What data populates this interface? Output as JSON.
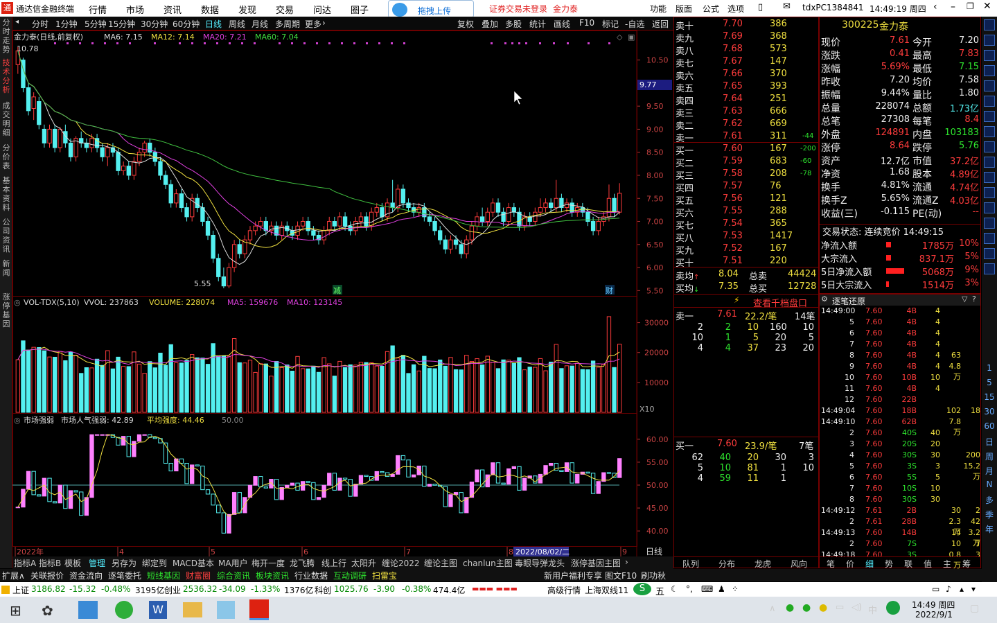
{
  "titlebar": {
    "app_name": "通达信金融终端",
    "menus": [
      "行情",
      "市场",
      "资讯",
      "数据",
      "发现",
      "交易",
      "问达",
      "圈子"
    ],
    "upload_label": "拖拽上传",
    "login_warning": "证券交易未登录",
    "stock_name": "金力泰",
    "right_menus": [
      "功能",
      "版面",
      "公式",
      "选项"
    ],
    "user_id": "tdxPC1384841",
    "clock": "14:49:19 周四"
  },
  "left_tabs": [
    "分时走势",
    "技术分析",
    "成交明细",
    "分价表",
    "基本资料",
    "公司资讯",
    "新闻",
    "涨停基因"
  ],
  "period_bar": {
    "items": [
      "分时",
      "1分钟",
      "5分钟",
      "15分钟",
      "30分钟",
      "60分钟",
      "日线",
      "周线",
      "月线",
      "多周期",
      "更多"
    ],
    "tools": [
      "复权",
      "叠加",
      "多股",
      "统计",
      "画线",
      "F10",
      "标记",
      "-自选",
      "返回"
    ]
  },
  "kline": {
    "header": "金力泰(日线,前复权)",
    "ma6": "MA6: 7.15",
    "ma12": "MA12: 7.14",
    "ma20": "MA20: 7.21",
    "ma60": "MA60: 7.04",
    "y_ticks": [
      "10.50",
      "10.00",
      "9.50",
      "9.00",
      "8.50",
      "8.00",
      "7.50",
      "7.00",
      "6.50",
      "6.00",
      "5.50"
    ],
    "high_label": "10.78",
    "low_label": "5.55",
    "cursor_price": "9.77",
    "marker_jian": "减",
    "marker_cai": "财"
  },
  "volume": {
    "header": "VOL-TDX(5,10)",
    "vvol": "VVOL: 237863",
    "volume": "VOLUME: 228074",
    "ma5": "MA5: 159676",
    "ma10": "MA10: 123145",
    "y_ticks": [
      "30000",
      "20000",
      "10000"
    ],
    "unit": "X10"
  },
  "strength": {
    "header": "市场强弱",
    "popularity": "市场人气强弱: 42.89",
    "avg": "平均强度: 44.46",
    "ref": "50.00",
    "y_ticks": [
      "60.00",
      "55.00",
      "50.00",
      "45.00",
      "40.00"
    ],
    "x_labels": [
      "2022年",
      "4",
      "5",
      "6",
      "7",
      "8",
      "9"
    ],
    "date_cursor": "2022/08/02/二",
    "period": "日线"
  },
  "order_book": {
    "sells": [
      {
        "label": "卖十",
        "price": "7.70",
        "vol": "386",
        "diff": ""
      },
      {
        "label": "卖九",
        "price": "7.69",
        "vol": "368",
        "diff": ""
      },
      {
        "label": "卖八",
        "price": "7.68",
        "vol": "573",
        "diff": ""
      },
      {
        "label": "卖七",
        "price": "7.67",
        "vol": "147",
        "diff": ""
      },
      {
        "label": "卖六",
        "price": "7.66",
        "vol": "370",
        "diff": ""
      },
      {
        "label": "卖五",
        "price": "7.65",
        "vol": "393",
        "diff": ""
      },
      {
        "label": "卖四",
        "price": "7.64",
        "vol": "251",
        "diff": ""
      },
      {
        "label": "卖三",
        "price": "7.63",
        "vol": "666",
        "diff": ""
      },
      {
        "label": "卖二",
        "price": "7.62",
        "vol": "669",
        "diff": ""
      },
      {
        "label": "卖一",
        "price": "7.61",
        "vol": "311",
        "diff": "-44"
      }
    ],
    "buys": [
      {
        "label": "买一",
        "price": "7.60",
        "vol": "167",
        "diff": "-200"
      },
      {
        "label": "买二",
        "price": "7.59",
        "vol": "683",
        "diff": "-60"
      },
      {
        "label": "买三",
        "price": "7.58",
        "vol": "208",
        "diff": "-78"
      },
      {
        "label": "买四",
        "price": "7.57",
        "vol": "76",
        "diff": ""
      },
      {
        "label": "买五",
        "price": "7.56",
        "vol": "121",
        "diff": ""
      },
      {
        "label": "买六",
        "price": "7.55",
        "vol": "288",
        "diff": ""
      },
      {
        "label": "买七",
        "price": "7.54",
        "vol": "365",
        "diff": ""
      },
      {
        "label": "买八",
        "price": "7.53",
        "vol": "1417",
        "diff": ""
      },
      {
        "label": "买九",
        "price": "7.52",
        "vol": "167",
        "diff": ""
      },
      {
        "label": "买十",
        "price": "7.51",
        "vol": "220",
        "diff": ""
      }
    ],
    "sell_avg_label": "卖均",
    "sell_avg": "8.04",
    "total_sell_label": "总卖",
    "total_sell": "44424",
    "buy_avg_label": "买均",
    "buy_avg": "7.35",
    "total_buy_label": "总买",
    "total_buy": "12728",
    "thousand_link": "查看千档盘口",
    "sell1_queue": {
      "label": "卖一",
      "price": "7.61",
      "per": "22.2/笔",
      "count": "14笔"
    },
    "sell1_rows": [
      [
        "2",
        "2",
        "10",
        "160",
        "10"
      ],
      [
        "10",
        "1",
        "5",
        "20",
        "5"
      ],
      [
        "4",
        "4",
        "37",
        "23",
        "20"
      ]
    ],
    "buy1_queue": {
      "label": "买一",
      "price": "7.60",
      "per": "23.9/笔",
      "count": "7笔"
    },
    "buy1_rows": [
      [
        "62",
        "40",
        "20",
        "30",
        "3"
      ],
      [
        "5",
        "10",
        "81",
        "1",
        "10"
      ],
      [
        "4",
        "59",
        "11",
        "1",
        ""
      ]
    ],
    "bottom_tabs": [
      "队列",
      "分布",
      "龙虎",
      "风向"
    ]
  },
  "detail": {
    "code": "300225",
    "name": "金力泰",
    "rows": [
      [
        "现价",
        "7.61",
        "今开",
        "7.20"
      ],
      [
        "涨跌",
        "0.41",
        "最高",
        "7.83"
      ],
      [
        "涨幅",
        "5.69%",
        "最低",
        "7.15"
      ],
      [
        "昨收",
        "7.20",
        "均价",
        "7.58"
      ],
      [
        "振幅",
        "9.44%",
        "量比",
        "1.80"
      ],
      [
        "总量",
        "228074",
        "总额",
        "1.73亿"
      ],
      [
        "总笔",
        "27308",
        "每笔",
        "8.4"
      ],
      [
        "外盘",
        "124891",
        "内盘",
        "103183"
      ],
      [
        "涨停",
        "8.64",
        "跌停",
        "5.76"
      ],
      [
        "资产",
        "12.7亿",
        "市值",
        "37.2亿"
      ],
      [
        "净资",
        "1.68",
        "股本",
        "4.89亿"
      ],
      [
        "换手",
        "4.81%",
        "流通",
        "4.74亿"
      ],
      [
        "换手Z",
        "5.65%",
        "流通Z",
        "4.03亿"
      ],
      [
        "收益(三)",
        "-0.115",
        "PE(动)",
        "--"
      ]
    ],
    "trade_state": "交易状态: 连续竞价 14:49:15",
    "flows": [
      [
        "净流入额",
        "1785万",
        "10%"
      ],
      [
        "大宗流入",
        "837.1万",
        "5%"
      ],
      [
        "5日净流入额",
        "5068万",
        "9%"
      ],
      [
        "5日大宗流入",
        "1514万",
        "3%"
      ]
    ]
  },
  "ticks": {
    "title": "逐笔还原",
    "rows": [
      [
        "14:49:00",
        "7.60",
        "4B",
        "4",
        "",
        ""
      ],
      [
        "5",
        "7.60",
        "4B",
        "4",
        "",
        ""
      ],
      [
        "6",
        "7.60",
        "4B",
        "4",
        "",
        ""
      ],
      [
        "7",
        "7.60",
        "4B",
        "4",
        "",
        ""
      ],
      [
        "8",
        "7.60",
        "4B",
        "4",
        "63",
        ""
      ],
      [
        "9",
        "7.60",
        "4B",
        "4",
        "4.8万",
        ""
      ],
      [
        "10",
        "7.60",
        "10B",
        "10",
        "",
        ""
      ],
      [
        "11",
        "7.60",
        "4B",
        "4",
        "",
        ""
      ],
      [
        "12",
        "7.60",
        "22B",
        "",
        "",
        ""
      ],
      [
        "14:49:04",
        "7.60",
        "18B",
        "",
        "102",
        "18"
      ],
      [
        "14:49:10",
        "7.60",
        "62B",
        "",
        "7.8万",
        ""
      ],
      [
        "2",
        "7.60",
        "40S",
        "40",
        "",
        ""
      ],
      [
        "3",
        "7.60",
        "20S",
        "20",
        "",
        ""
      ],
      [
        "4",
        "7.60",
        "30S",
        "30",
        "",
        "200"
      ],
      [
        "5",
        "7.60",
        "3S",
        "3",
        "",
        "15.2万"
      ],
      [
        "6",
        "7.60",
        "5S",
        "5",
        "",
        ""
      ],
      [
        "7",
        "7.60",
        "10S",
        "10",
        "",
        ""
      ],
      [
        "8",
        "7.60",
        "30S",
        "30",
        "",
        ""
      ],
      [
        "14:49:12",
        "7.61",
        "2B",
        "",
        "30",
        "2"
      ],
      [
        "2",
        "7.61",
        "28B",
        "",
        "2.3万",
        "42"
      ],
      [
        "14:49:13",
        "7.60",
        "14B",
        "",
        "14",
        "3.2万"
      ],
      [
        "2",
        "7.60",
        "7S",
        "",
        "10",
        "7"
      ],
      [
        "14:49:18",
        "7.60",
        "3S",
        "",
        "0.8万",
        "3"
      ]
    ],
    "bottom_tabs": [
      "笔",
      "价",
      "细",
      "势",
      "联",
      "值",
      "主",
      "筹"
    ]
  },
  "right_tools": [
    "1",
    "5",
    "15",
    "30",
    "60",
    "日",
    "周",
    "月",
    "N",
    "多",
    "季",
    "年"
  ],
  "bottom_tabs": [
    "指标A",
    "指标B",
    "模板",
    "管理",
    "另存为",
    "绑定到",
    "MACD基本",
    "MA用户",
    "梅开一度",
    "龙飞腾",
    "线上行",
    "太阳升",
    "缠论2022",
    "缠论主图",
    "chanlun主图",
    "毒眼导弹龙头",
    "涨停基因主图"
  ],
  "bottom_links": [
    "扩展∧",
    "关联报价",
    "资金流向",
    "逐笔委托",
    "短线基因",
    "财富圈",
    "综合资讯",
    "板块资讯",
    "行业数据",
    "互动调研",
    "扫雷宝",
    "新用户福利专享",
    "图文F10",
    "刷功秋"
  ],
  "index_bar": {
    "sh_label": "上证",
    "sh": "3186.82",
    "sh_chg": "-15.32",
    "sh_pct": "-0.48%",
    "sh_amt": "3195亿",
    "cy_label": "创业",
    "cy": "2536.32",
    "cy_chg": "-34.09",
    "cy_pct": "-1.33%",
    "cy_amt": "1376亿",
    "kc_label": "科创",
    "kc": "1025.76",
    "kc_chg": "-3.90",
    "kc_pct": "-0.38%",
    "kc_amt": "474.4亿",
    "adv_quote": "高级行情",
    "line": "上海双线11"
  },
  "taskbar": {
    "time": "14:49 周四",
    "date": "2022/9/1",
    "ime": "中"
  },
  "chart_data": {
    "type": "candlestick",
    "ylim": [
      5.4,
      10.9
    ],
    "candles": [
      [
        10.4,
        10.7,
        10.78,
        10.2
      ],
      [
        10.5,
        9.9,
        10.55,
        9.8
      ],
      [
        9.9,
        9.4,
        10.0,
        9.3
      ],
      [
        9.45,
        9.7,
        9.8,
        9.2
      ],
      [
        9.6,
        9.1,
        9.7,
        9.0
      ],
      [
        9.0,
        8.7,
        9.1,
        8.6
      ],
      [
        8.7,
        9.0,
        9.1,
        8.6
      ],
      [
        9.0,
        8.6,
        9.1,
        8.5
      ],
      [
        8.6,
        9.0,
        9.05,
        8.5
      ],
      [
        8.95,
        8.7,
        9.1,
        8.6
      ],
      [
        8.7,
        8.4,
        8.8,
        8.3
      ],
      [
        8.4,
        8.8,
        8.85,
        8.3
      ],
      [
        8.8,
        8.7,
        8.95,
        8.6
      ],
      [
        8.7,
        8.6,
        8.8,
        8.5
      ],
      [
        8.6,
        8.8,
        8.9,
        8.5
      ],
      [
        8.8,
        8.6,
        8.9,
        8.5
      ],
      [
        8.6,
        8.4,
        8.7,
        8.3
      ],
      [
        8.4,
        8.6,
        8.7,
        8.2
      ],
      [
        8.6,
        8.5,
        8.7,
        8.4
      ],
      [
        8.5,
        8.1,
        8.6,
        8.0
      ],
      [
        8.1,
        8.2,
        8.3,
        8.0
      ],
      [
        8.2,
        8.0,
        8.3,
        7.9
      ],
      [
        8.0,
        8.3,
        8.4,
        7.9
      ],
      [
        8.3,
        8.5,
        8.6,
        8.2
      ],
      [
        8.5,
        8.7,
        8.75,
        8.4
      ],
      [
        8.7,
        8.5,
        8.8,
        8.4
      ],
      [
        8.5,
        8.3,
        8.6,
        8.2
      ],
      [
        8.3,
        8.0,
        8.4,
        7.9
      ],
      [
        8.0,
        7.8,
        8.1,
        7.7
      ],
      [
        7.8,
        7.4,
        7.9,
        7.3
      ],
      [
        7.4,
        7.6,
        7.7,
        7.3
      ],
      [
        7.6,
        7.3,
        7.7,
        7.2
      ],
      [
        7.3,
        7.1,
        7.4,
        7.0
      ],
      [
        7.1,
        7.5,
        7.6,
        7.0
      ],
      [
        7.5,
        7.3,
        7.6,
        7.2
      ],
      [
        7.3,
        7.0,
        7.4,
        6.9
      ],
      [
        7.0,
        6.7,
        7.1,
        6.6
      ],
      [
        6.7,
        6.2,
        6.8,
        6.1
      ],
      [
        6.2,
        5.8,
        6.3,
        5.7
      ],
      [
        5.8,
        5.6,
        6.0,
        5.55
      ],
      [
        5.6,
        6.0,
        6.1,
        5.55
      ],
      [
        6.0,
        6.5,
        6.6,
        5.9
      ],
      [
        6.5,
        6.3,
        6.6,
        6.2
      ],
      [
        6.3,
        6.6,
        6.7,
        6.2
      ],
      [
        6.6,
        6.8,
        6.9,
        6.5
      ],
      [
        6.8,
        6.9,
        7.0,
        6.7
      ],
      [
        6.9,
        7.0,
        7.1,
        6.8
      ],
      [
        7.0,
        6.8,
        7.1,
        6.7
      ],
      [
        6.8,
        6.9,
        7.0,
        6.7
      ],
      [
        6.9,
        6.7,
        7.0,
        6.6
      ],
      [
        6.7,
        6.9,
        7.0,
        6.6
      ],
      [
        6.9,
        6.8,
        7.0,
        6.7
      ],
      [
        6.8,
        6.7,
        6.9,
        6.6
      ],
      [
        6.7,
        6.9,
        7.0,
        6.6
      ],
      [
        6.9,
        7.0,
        7.1,
        6.8
      ],
      [
        7.0,
        6.8,
        7.1,
        6.7
      ],
      [
        6.8,
        6.7,
        6.9,
        6.6
      ],
      [
        6.7,
        6.6,
        6.8,
        6.5
      ],
      [
        6.6,
        6.8,
        6.9,
        6.5
      ],
      [
        6.8,
        7.0,
        7.1,
        6.7
      ],
      [
        7.0,
        6.9,
        7.1,
        6.8
      ],
      [
        6.9,
        7.1,
        7.2,
        6.8
      ],
      [
        7.1,
        6.9,
        7.2,
        6.8
      ],
      [
        6.9,
        6.8,
        7.0,
        6.7
      ],
      [
        6.8,
        7.0,
        7.1,
        6.7
      ],
      [
        7.0,
        7.1,
        7.2,
        6.9
      ],
      [
        7.1,
        6.9,
        7.2,
        6.8
      ],
      [
        6.9,
        7.2,
        7.3,
        6.8
      ],
      [
        7.2,
        7.3,
        7.4,
        7.1
      ],
      [
        7.3,
        7.1,
        7.4,
        7.0
      ],
      [
        7.1,
        7.4,
        7.5,
        7.0
      ],
      [
        7.4,
        7.3,
        7.9,
        7.2
      ],
      [
        7.3,
        7.7,
        7.8,
        7.2
      ],
      [
        7.7,
        7.4,
        7.8,
        7.3
      ],
      [
        7.4,
        7.3,
        7.5,
        7.2
      ],
      [
        7.3,
        7.2,
        7.4,
        7.1
      ],
      [
        7.2,
        7.3,
        7.4,
        7.1
      ],
      [
        7.3,
        7.1,
        7.4,
        7.0
      ],
      [
        7.1,
        7.0,
        7.2,
        6.9
      ],
      [
        7.0,
        6.8,
        7.1,
        6.7
      ],
      [
        6.8,
        6.6,
        6.9,
        6.5
      ],
      [
        6.6,
        6.4,
        6.7,
        6.3
      ],
      [
        6.4,
        6.6,
        6.7,
        6.3
      ],
      [
        6.6,
        6.5,
        6.7,
        6.4
      ],
      [
        6.5,
        6.3,
        6.6,
        6.2
      ],
      [
        6.3,
        6.6,
        6.7,
        6.2
      ],
      [
        6.6,
        6.9,
        7.0,
        6.5
      ],
      [
        6.9,
        7.1,
        7.2,
        6.8
      ],
      [
        7.1,
        7.0,
        7.3,
        6.9
      ],
      [
        7.0,
        7.2,
        7.3,
        6.9
      ],
      [
        7.2,
        7.4,
        7.5,
        7.1
      ],
      [
        7.4,
        7.2,
        7.5,
        7.1
      ],
      [
        7.2,
        7.0,
        7.3,
        6.9
      ],
      [
        7.0,
        7.3,
        7.4,
        6.9
      ],
      [
        7.3,
        7.2,
        7.4,
        7.1
      ],
      [
        7.2,
        6.9,
        7.3,
        6.8
      ],
      [
        6.9,
        7.1,
        7.2,
        6.8
      ],
      [
        7.1,
        7.0,
        7.2,
        6.9
      ],
      [
        7.0,
        7.2,
        7.3,
        6.9
      ],
      [
        7.2,
        7.3,
        7.5,
        7.1
      ],
      [
        7.3,
        7.4,
        7.5,
        7.2
      ],
      [
        7.4,
        7.3,
        7.5,
        7.2
      ],
      [
        7.3,
        7.5,
        7.9,
        7.2
      ],
      [
        7.5,
        7.3,
        7.6,
        7.2
      ],
      [
        7.3,
        7.4,
        7.5,
        7.2
      ],
      [
        7.4,
        7.2,
        7.5,
        7.1
      ],
      [
        7.2,
        7.3,
        7.4,
        7.1
      ],
      [
        7.3,
        7.2,
        7.4,
        7.1
      ],
      [
        7.2,
        7.0,
        7.3,
        6.9
      ],
      [
        7.0,
        6.8,
        7.1,
        6.7
      ],
      [
        6.8,
        7.0,
        7.1,
        6.7
      ],
      [
        7.0,
        7.1,
        7.2,
        6.9
      ],
      [
        7.1,
        7.5,
        7.8,
        7.0
      ],
      [
        7.5,
        7.2,
        7.6,
        7.1
      ],
      [
        7.2,
        7.61,
        7.83,
        7.15
      ]
    ]
  }
}
